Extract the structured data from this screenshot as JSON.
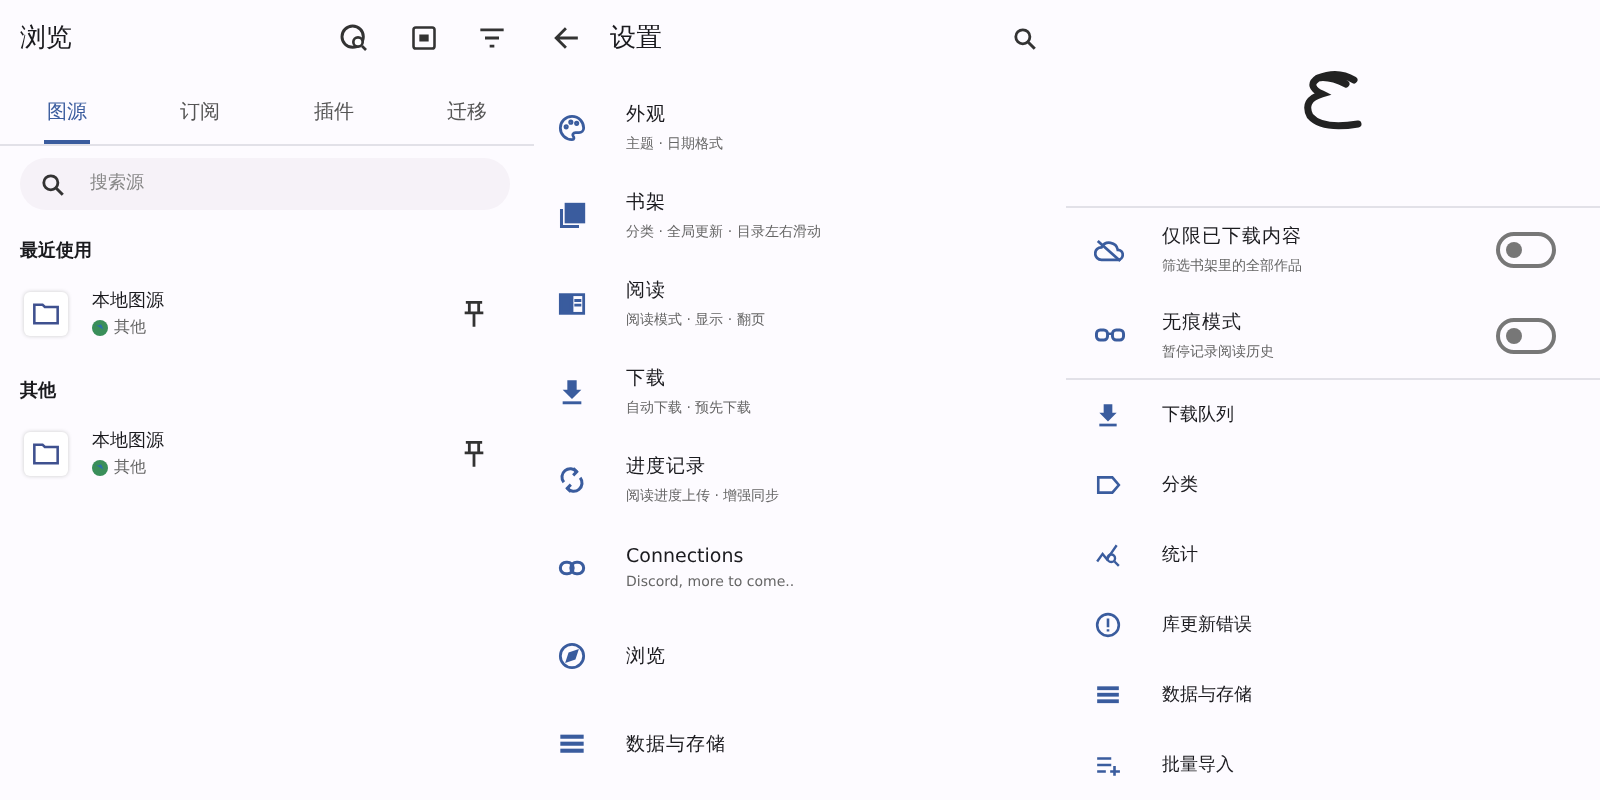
{
  "browse": {
    "title": "浏览",
    "tabs": [
      {
        "label": "图源",
        "selected": true
      },
      {
        "label": "订阅",
        "selected": false
      },
      {
        "label": "插件",
        "selected": false
      },
      {
        "label": "迁移",
        "selected": false
      }
    ],
    "search": {
      "placeholder": "搜索源"
    },
    "sections": [
      {
        "heading": "最近使用",
        "items": [
          {
            "title": "本地图源",
            "language": "其他"
          }
        ]
      },
      {
        "heading": "其他",
        "items": [
          {
            "title": "本地图源",
            "language": "其他"
          }
        ]
      }
    ]
  },
  "settings": {
    "title": "设置",
    "items": [
      {
        "title": "外观",
        "subtitle": "主题 · 日期格式"
      },
      {
        "title": "书架",
        "subtitle": "分类 · 全局更新 · 目录左右滑动"
      },
      {
        "title": "阅读",
        "subtitle": "阅读模式 · 显示 · 翻页"
      },
      {
        "title": "下载",
        "subtitle": "自动下载 · 预先下载"
      },
      {
        "title": "进度记录",
        "subtitle": "阅读进度上传 · 增强同步"
      },
      {
        "title": "Connections",
        "subtitle": "Discord, more to come.."
      },
      {
        "title": "浏览"
      },
      {
        "title": "数据与存储"
      }
    ]
  },
  "more": {
    "toggles": [
      {
        "title": "仅限已下载内容",
        "subtitle": "筛选书架里的全部作品",
        "on": false
      },
      {
        "title": "无痕模式",
        "subtitle": "暂停记录阅读历史",
        "on": false
      }
    ],
    "items": [
      "下载队列",
      "分类",
      "统计",
      "库更新错误",
      "数据与存储",
      "批量导入"
    ]
  }
}
